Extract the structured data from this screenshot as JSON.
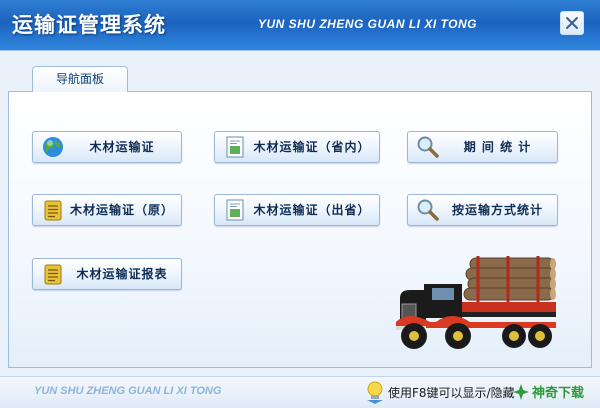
{
  "window": {
    "title": "运输证管理系统",
    "pinyin_title": "YUN SHU ZHENG GUAN LI XI TONG"
  },
  "nav": {
    "tab_label": "导航面板",
    "buttons": [
      {
        "label": "木材运输证",
        "icon": "globe-icon"
      },
      {
        "label": "木材运输证（省内）",
        "icon": "document-icon"
      },
      {
        "label": "期 间 统 计",
        "icon": "magnifier-icon"
      },
      {
        "label": "木材运输证（原）",
        "icon": "notepad-icon"
      },
      {
        "label": "木材运输证（出省）",
        "icon": "document-icon"
      },
      {
        "label": "按运输方式统计",
        "icon": "magnifier-icon"
      },
      {
        "label": "木材运输证报表",
        "icon": "notepad-icon"
      }
    ]
  },
  "footer": {
    "pinyin": "YUN SHU ZHENG GUAN LI XI TONG",
    "hint": "使用F8键可以显示/隐藏"
  },
  "watermark": {
    "text": "神奇下载"
  },
  "colors": {
    "header_blue": "#1c63bf",
    "panel_border": "#9dbde0",
    "button_text": "#0f2d55"
  }
}
